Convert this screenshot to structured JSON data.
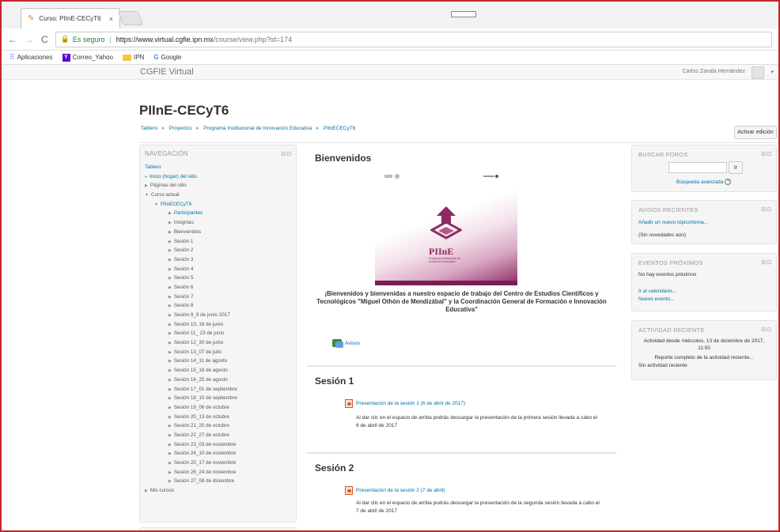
{
  "browser": {
    "tab_title": "Curso: PIInE-CECyT6",
    "tab_close": "×",
    "back": "←",
    "forward": "→",
    "reload": "C",
    "secure_label": "Es seguro",
    "url_host": "https://www.virtual.cgfie.ipn.mx",
    "url_path": "/course/view.php?id=174",
    "bookmarks": [
      {
        "label": "Aplicaciones"
      },
      {
        "label": "Correo_Yahoo"
      },
      {
        "label": "IPN"
      },
      {
        "label": "Google"
      }
    ]
  },
  "header": {
    "site_name": "CGFIE Virtual",
    "user_name": "Carlos Zavala Hernández",
    "course_title": "PIInE-CECyT6",
    "breadcrumb": [
      "Tablero",
      "Proyectos",
      "Programa Institucional de Innovación Educativa",
      "PIInECECyT6"
    ],
    "edit_button": "Activar edición"
  },
  "navigation": {
    "title": "NAVEGACIÓN",
    "items": [
      {
        "label": "Tablero",
        "level": 1,
        "link": true,
        "arrow": ""
      },
      {
        "label": "Inicio (hogar) del sitio",
        "level": 1,
        "link": true,
        "arrow": "●"
      },
      {
        "label": "Páginas del sitio",
        "level": 1,
        "link": false,
        "arrow": "▶"
      },
      {
        "label": "Curso actual",
        "level": 1,
        "link": false,
        "arrow": "▼"
      },
      {
        "label": "PIInECECyT6",
        "level": 2,
        "link": true,
        "arrow": "▼"
      },
      {
        "label": "Participantes",
        "level": 3,
        "link": true,
        "arrow": "▶"
      },
      {
        "label": "Insignias",
        "level": 3,
        "link": false,
        "arrow": "▶"
      },
      {
        "label": "Bienvenidos",
        "level": 3,
        "link": false,
        "arrow": "▶"
      },
      {
        "label": "Sesión 1",
        "level": 3,
        "link": false,
        "arrow": "▶"
      },
      {
        "label": "Sesión 2",
        "level": 3,
        "link": false,
        "arrow": "▶"
      },
      {
        "label": "Sesión 3",
        "level": 3,
        "link": false,
        "arrow": "▶"
      },
      {
        "label": "Sesión 4",
        "level": 3,
        "link": false,
        "arrow": "▶"
      },
      {
        "label": "Sesión 5",
        "level": 3,
        "link": false,
        "arrow": "▶"
      },
      {
        "label": "Sesión 6",
        "level": 3,
        "link": false,
        "arrow": "▶"
      },
      {
        "label": "Sesión 7",
        "level": 3,
        "link": false,
        "arrow": "▶"
      },
      {
        "label": "Sesión 8",
        "level": 3,
        "link": false,
        "arrow": "▶"
      },
      {
        "label": "Sesión 9_9 de junio 2017",
        "level": 3,
        "link": false,
        "arrow": "▶"
      },
      {
        "label": "Sesión 10, 16 de junio",
        "level": 3,
        "link": false,
        "arrow": "▶"
      },
      {
        "label": "Sesión 11_ 23 de junio",
        "level": 3,
        "link": false,
        "arrow": "▶"
      },
      {
        "label": "Sesión 12_30 de junio",
        "level": 3,
        "link": false,
        "arrow": "▶"
      },
      {
        "label": "Sesión 13_07 de julio",
        "level": 3,
        "link": false,
        "arrow": "▶"
      },
      {
        "label": "Sesión 14_11 de agosto",
        "level": 3,
        "link": false,
        "arrow": "▶"
      },
      {
        "label": "Sesión 15_18 de agosto",
        "level": 3,
        "link": false,
        "arrow": "▶"
      },
      {
        "label": "Sesión 16_25 de agosto",
        "level": 3,
        "link": false,
        "arrow": "▶"
      },
      {
        "label": "Sesión 17_01 de septiembre",
        "level": 3,
        "link": false,
        "arrow": "▶"
      },
      {
        "label": "Sesión 18_15 de septiembre",
        "level": 3,
        "link": false,
        "arrow": "▶"
      },
      {
        "label": "Sesión 19_06 de octubre",
        "level": 3,
        "link": false,
        "arrow": "▶"
      },
      {
        "label": "Sesión 20_13 de octubre",
        "level": 3,
        "link": false,
        "arrow": "▶"
      },
      {
        "label": "Sesión 21_20 de octubre",
        "level": 3,
        "link": false,
        "arrow": "▶"
      },
      {
        "label": "Sesión 22_27 de octubre",
        "level": 3,
        "link": false,
        "arrow": "▶"
      },
      {
        "label": "Sesión 23_03 de noviembre",
        "level": 3,
        "link": false,
        "arrow": "▶"
      },
      {
        "label": "Sesión 24_10 de noviembre",
        "level": 3,
        "link": false,
        "arrow": "▶"
      },
      {
        "label": "Sesión 25_17 de noviembre",
        "level": 3,
        "link": false,
        "arrow": "▶"
      },
      {
        "label": "Sesión 26_24 de noviembre",
        "level": 3,
        "link": false,
        "arrow": "▶"
      },
      {
        "label": "Sesión 27_08 de diciembre",
        "level": 3,
        "link": false,
        "arrow": "▶"
      },
      {
        "label": "Mis cursos",
        "level": 1,
        "link": false,
        "arrow": "▶"
      }
    ]
  },
  "main": {
    "welcome_title": "Bienvenidos",
    "banner_title": "PIInE",
    "banner_subtitle": "Programa Institucional de Innovación Educativa",
    "welcome_text": "¡Bienvenidos y bienvenidas a nuestro espacio de trabajo del Centro de Estudios Científicos y Tecnológicos \"Miguel Othón de Mendizábal\" y la Coordinación General de Formación e Innovación Educativa\"",
    "forum_link": "Avisos",
    "sections": [
      {
        "title": "Sesión 1",
        "resource": "Presentación de la sesión 1 (6 de abril de 2017)",
        "description": "Al dar clic en el espacio de arriba podrás descargar la presentación de la primera sesión llevada a cabo el 6 de abril de 2017"
      },
      {
        "title": "Sesión 2",
        "resource": "Presentación de la sesión 2 (7 de abril)",
        "description": "Al dar clic en el espacio de arriba podrás descargar la presentación de la segunda sesión llevada a cabo el 7 de abril de 2017"
      }
    ]
  },
  "right": {
    "search": {
      "title": "BUSCAR FOROS",
      "button": "Ir",
      "advanced": "Búsqueda avanzada",
      "help": "?"
    },
    "news": {
      "title": "AVISOS RECIENTES",
      "add_topic": "Añadir un nuevo tópico/tema...",
      "empty": "(Sin novedades aún)"
    },
    "events": {
      "title": "EVENTOS PRÓXIMOS",
      "empty": "No hay eventos próximos",
      "calendar": "Ir al calendario...",
      "new_event": "Nuevo evento..."
    },
    "activity": {
      "title": "ACTIVIDAD RECIENTE",
      "since": "Actividad desde miércoles, 13 de diciembre de 2017, 11:50",
      "full_report": "Reporte completo de la actividad reciente...",
      "empty": "Sin actividad reciente"
    }
  },
  "colors": {
    "link": "#0070a8",
    "frame": "#c0272d",
    "brand": "#8e2a63"
  }
}
